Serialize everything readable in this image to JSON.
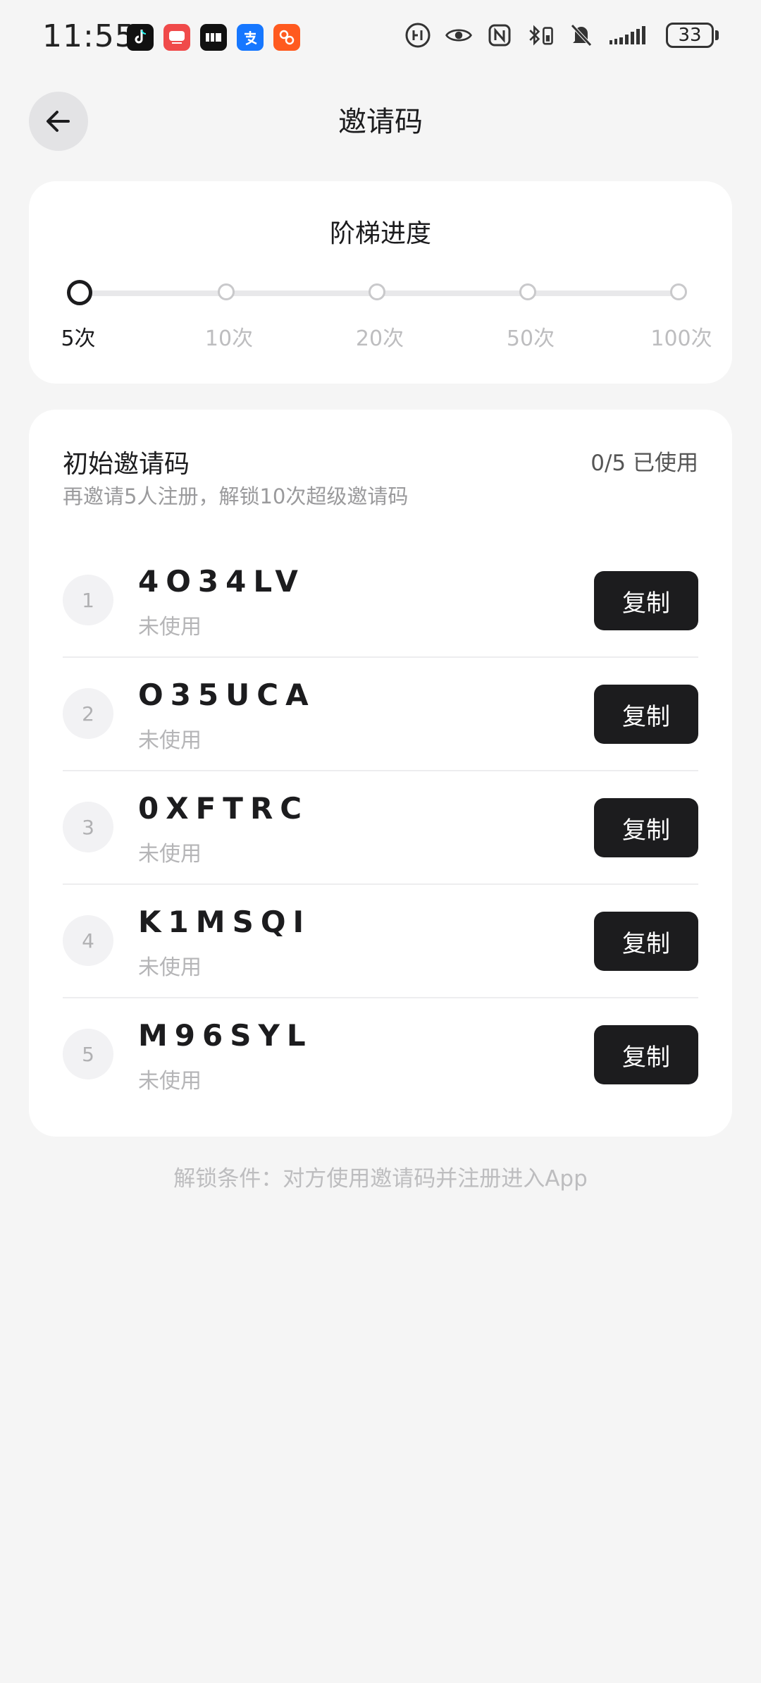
{
  "status_bar": {
    "time": "11:55",
    "battery": "33",
    "app_icons": [
      "tiktok-icon",
      "tv-app-icon",
      "chat-app-icon",
      "alipay-icon",
      "taobao-icon"
    ],
    "system_icons": [
      "hd-icon",
      "eye-icon",
      "nfc-icon",
      "bluetooth-icon",
      "battery-saver-icon",
      "mute-icon",
      "signal-icon"
    ]
  },
  "header": {
    "title": "邀请码",
    "back_icon": "arrow-left-icon"
  },
  "progress": {
    "title": "阶梯进度",
    "current_step": 0,
    "steps": [
      {
        "label": "5次"
      },
      {
        "label": "10次"
      },
      {
        "label": "20次"
      },
      {
        "label": "50次"
      },
      {
        "label": "100次"
      }
    ]
  },
  "codes": {
    "title": "初始邀请码",
    "used_summary": "0/5 已使用",
    "subtitle": "再邀请5人注册，解锁10次超级邀请码",
    "copy_label": "复制",
    "items": [
      {
        "index": "1",
        "code": "4O34LV",
        "status": "未使用"
      },
      {
        "index": "2",
        "code": "O35UCA",
        "status": "未使用"
      },
      {
        "index": "3",
        "code": "0XFTRC",
        "status": "未使用"
      },
      {
        "index": "4",
        "code": "K1MSQI",
        "status": "未使用"
      },
      {
        "index": "5",
        "code": "M96SYL",
        "status": "未使用"
      }
    ]
  },
  "footer": {
    "note": "解锁条件：对方使用邀请码并注册进入App"
  },
  "colors": {
    "background": "#f5f5f5",
    "card": "#ffffff",
    "primary": "#1c1c1e",
    "muted": "#bdbdbf"
  }
}
